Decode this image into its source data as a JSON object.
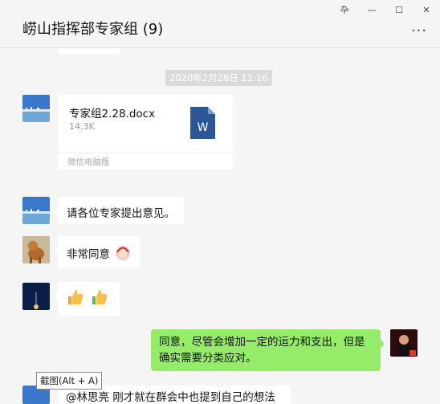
{
  "window": {
    "title": "崂山指挥部专家组 (9)",
    "pin_glyph": "卆",
    "minimize_glyph": "—",
    "maximize_glyph": "☐",
    "close_glyph": "✕",
    "more_glyph": "···"
  },
  "messages": {
    "timestamp": "2020年2月28日 11:16",
    "file": {
      "name": "专家组2.28.docx",
      "size": "14.3K",
      "source": "微信电脑版",
      "icon_letter": "W"
    },
    "msg1": "请各位专家提出意见。",
    "msg2": "非常同意",
    "msg4": "同意，尽管会增加一定的运力和支出，但是确实需要分类应对。",
    "msg5_partial": "@林思亮 刚才就在群会中也提到自己的想法"
  },
  "tooltip": "截图(Alt + A)",
  "colors": {
    "self_bubble": "#95ec69",
    "word_icon": "#2b5797"
  }
}
